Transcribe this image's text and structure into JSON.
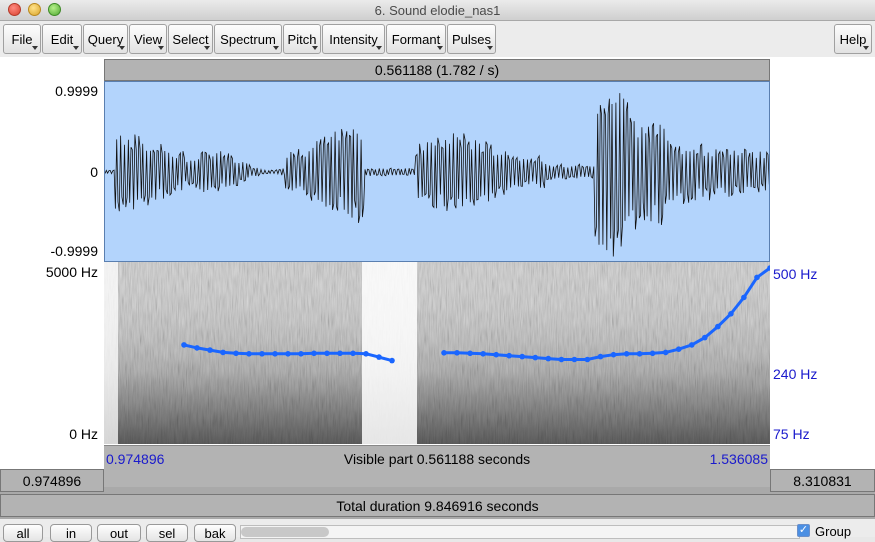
{
  "window": {
    "title": "6. Sound elodie_nas1"
  },
  "menu": [
    {
      "label": "File"
    },
    {
      "label": "Edit"
    },
    {
      "label": "Query"
    },
    {
      "label": "View"
    },
    {
      "label": "Select"
    },
    {
      "label": "Spectrum"
    },
    {
      "label": "Pitch"
    },
    {
      "label": "Intensity"
    },
    {
      "label": "Formant"
    },
    {
      "label": "Pulses"
    }
  ],
  "help_label": "Help",
  "selection_header": "0.561188 (1.782 / s)",
  "waveform": {
    "y_top": "0.9999",
    "y_mid": "0",
    "y_bottom": "-0.9999",
    "bg_color": "#b3d4fc"
  },
  "spectrogram": {
    "freq_top": "5000 Hz",
    "freq_bottom": "0 Hz",
    "pitch_top": "500 Hz",
    "pitch_mid": "240 Hz",
    "pitch_bottom": "75 Hz",
    "pitch_color": "#1a66ff"
  },
  "status": {
    "left_time": "0.974896",
    "center": "Visible part 0.561188 seconds",
    "right_time": "1.536085"
  },
  "outer": {
    "start": "0.974896",
    "end": "8.310831"
  },
  "total_duration": "Total duration 9.846916 seconds",
  "buttons": {
    "all": "all",
    "in": "in",
    "out": "out",
    "sel": "sel",
    "bak": "bak"
  },
  "group": {
    "label": "Group",
    "checked": true
  },
  "chart_data": {
    "type": "line",
    "series": [
      {
        "name": "",
        "segment": 1,
        "y_hz": [
          212,
          205,
          200,
          195,
          193,
          192,
          192,
          192,
          192,
          192,
          193,
          193,
          193,
          193,
          192,
          185,
          178
        ]
      },
      {
        "name": "",
        "segment": 2,
        "y_hz": [
          194,
          194,
          193,
          192,
          190,
          188,
          186,
          184,
          182,
          180,
          180,
          180,
          186,
          190,
          192,
          192,
          193,
          195,
          202,
          212,
          230,
          260,
          300,
          360,
          450,
          500
        ]
      }
    ],
    "ylim": [
      75,
      500
    ],
    "y_scale": "log"
  }
}
